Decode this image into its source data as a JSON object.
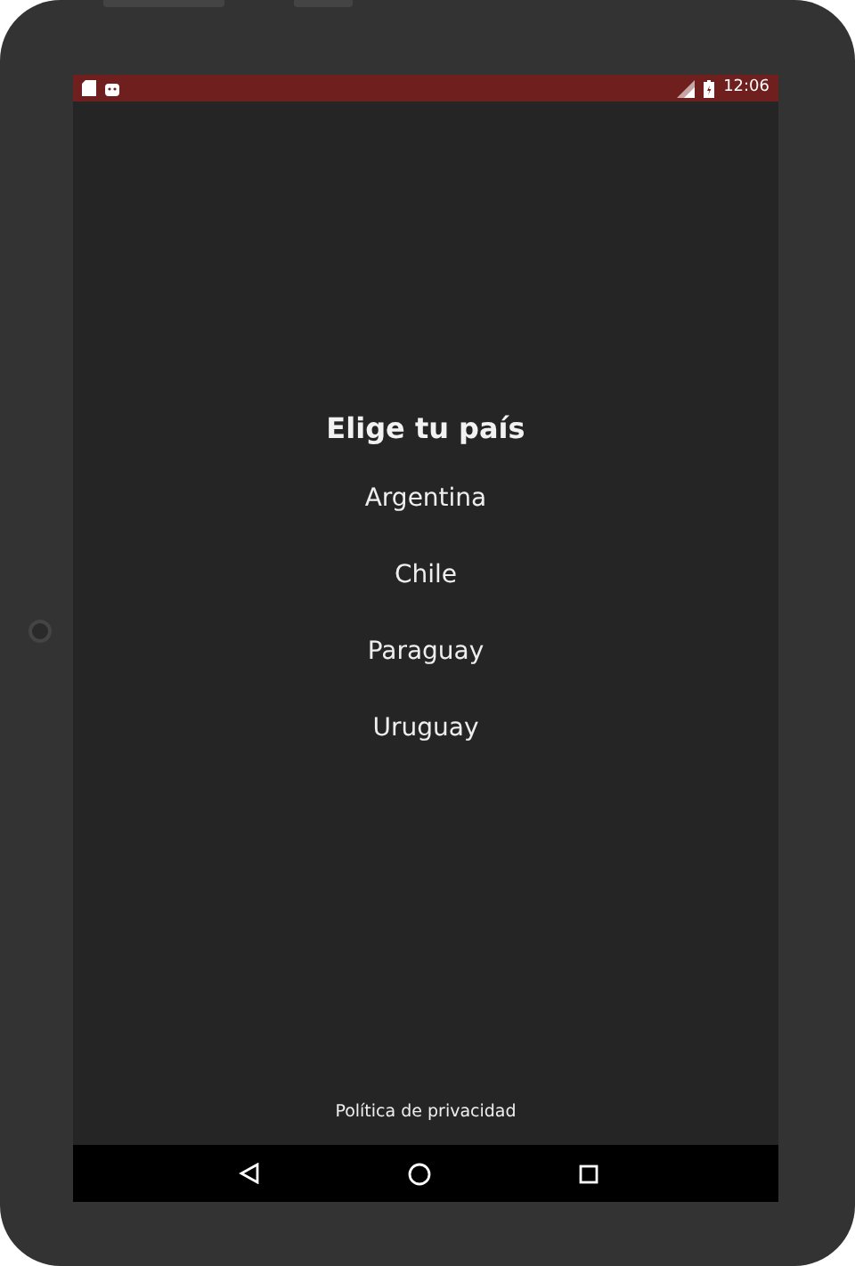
{
  "status_bar": {
    "time": "12:06"
  },
  "title": "Elige tu país",
  "countries": [
    "Argentina",
    "Chile",
    "Paraguay",
    "Uruguay"
  ],
  "footer_link": "Política de privacidad"
}
